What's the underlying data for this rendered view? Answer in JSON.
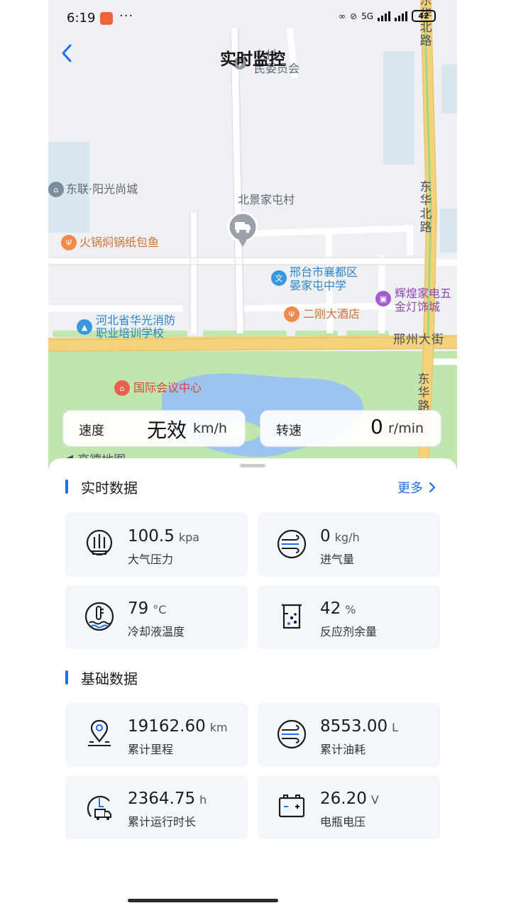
{
  "status_bar": {
    "time": "6:19",
    "dots": "···",
    "signal_label": "5G",
    "battery": "42"
  },
  "header": {
    "title": "实时监控"
  },
  "map": {
    "pois": {
      "village_committee_1": "屯村",
      "village_committee_2": "民委员会",
      "donglian": "东联·阳光尚城",
      "beijing_village": "北景家屯村",
      "hotpot": "火锅焖锅纸包鱼",
      "school_1": "邢台市襄都区",
      "school_2": "晏家屯中学",
      "appliance_1": "辉煌家电五",
      "appliance_2": "金灯饰城",
      "firefight_1": "河北省华光消防",
      "firefight_2": "职业培训学校",
      "hotel": "二刚大酒店",
      "conference": "国际会议中心"
    },
    "roads": {
      "xingzhou": "邢州大街",
      "donghua_top": "东华北路",
      "donghua_mid": "东华北路",
      "donghua_bottom": "东华路"
    },
    "provider_logo": "高德地图"
  },
  "speed": {
    "label": "速度",
    "value": "无效",
    "unit": "km/h"
  },
  "rpm": {
    "label": "转速",
    "value": "0",
    "unit": "r/min"
  },
  "realtime": {
    "title": "实时数据",
    "more_label": "更多",
    "cards": [
      {
        "value": "100.5",
        "unit": "kpa",
        "caption": "大气压力",
        "icon": "pressure-icon"
      },
      {
        "value": "0",
        "unit": "kg/h",
        "caption": "进气量",
        "icon": "airflow-icon"
      },
      {
        "value": "79",
        "unit": "°C",
        "caption": "冷却液温度",
        "icon": "coolant-temp-icon"
      },
      {
        "value": "42",
        "unit": "%",
        "caption": "反应剂余量",
        "icon": "reagent-icon"
      }
    ]
  },
  "basic": {
    "title": "基础数据",
    "cards": [
      {
        "value": "19162.60",
        "unit": "km",
        "caption": "累计里程",
        "icon": "mileage-pin-icon"
      },
      {
        "value": "8553.00",
        "unit": "L",
        "caption": "累计油耗",
        "icon": "fuel-wind-icon"
      },
      {
        "value": "2364.75",
        "unit": "h",
        "caption": "累计运行时长",
        "icon": "runtime-truck-icon"
      },
      {
        "value": "26.20",
        "unit": "V",
        "caption": "电瓶电压",
        "icon": "battery-icon"
      }
    ]
  },
  "colors": {
    "accent": "#1f6ff1",
    "card_bg": "#f3f6fb",
    "road_yellow": "#f3d27b",
    "water": "#9cc4ef",
    "park": "#bfe6ad"
  }
}
